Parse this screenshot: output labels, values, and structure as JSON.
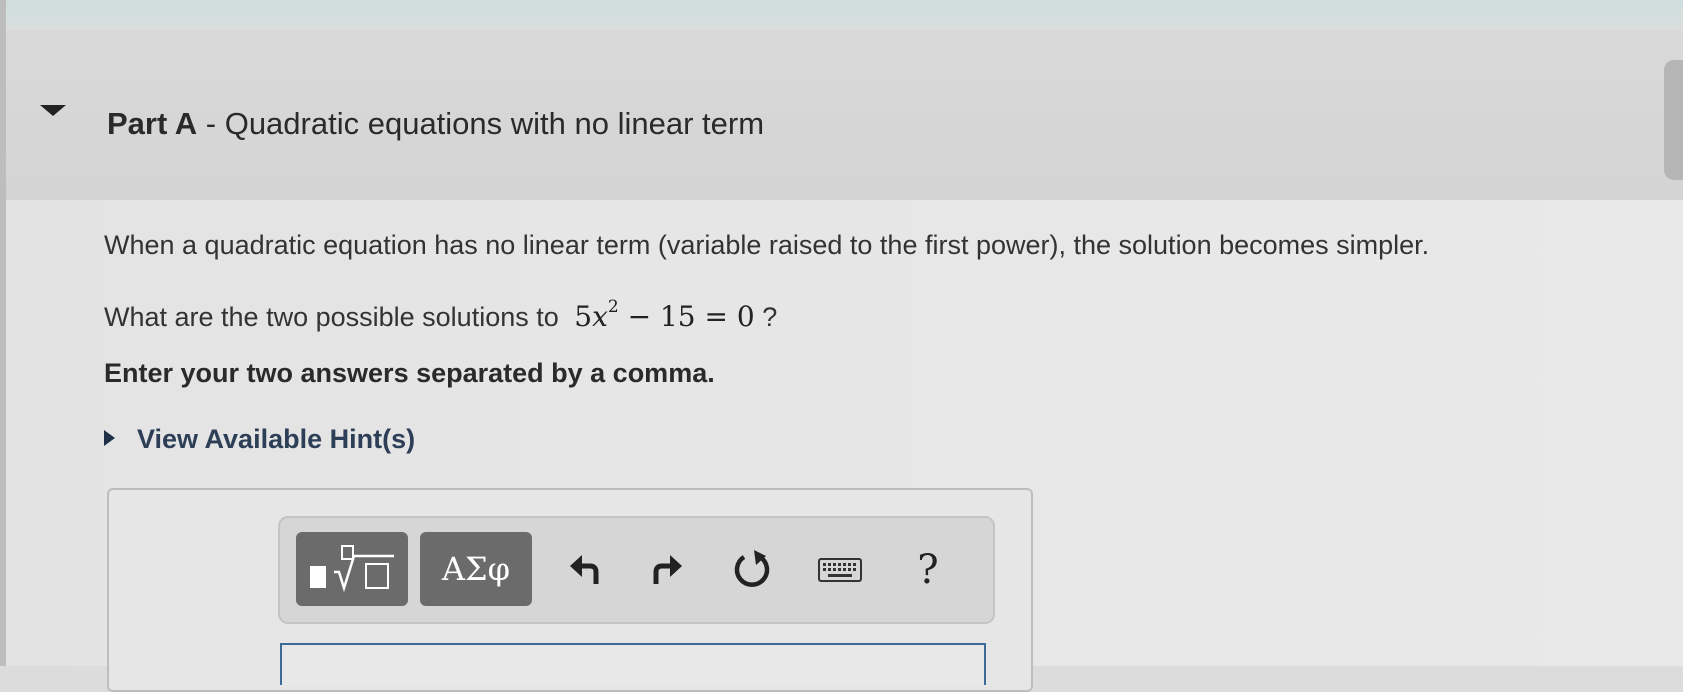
{
  "part": {
    "title_bold": "Part A",
    "title_rest": " - Quadratic equations with no linear term"
  },
  "body": {
    "intro": "When a quadratic equation has no linear term (variable raised to the first power), the solution becomes simpler.",
    "question_prefix": "What are the two possible solutions to",
    "equation": {
      "coef": "5",
      "var": "x",
      "exp": "2",
      "rest": " − 15 = 0"
    },
    "question_suffix": " ?",
    "instruction": "Enter your two answers separated by a comma."
  },
  "hint": {
    "label": "View Available Hint(s)"
  },
  "toolbar": {
    "greek_label": "ΑΣφ",
    "help_label": "?",
    "icons": [
      "templates-icon",
      "undo-icon",
      "redo-icon",
      "reset-icon",
      "keyboard-icon"
    ]
  },
  "answer_input": {
    "value": ""
  },
  "colors": {
    "dark_button": "#6b6b6b",
    "input_border": "#3e6a9a",
    "hint_text": "#2d3e57"
  }
}
